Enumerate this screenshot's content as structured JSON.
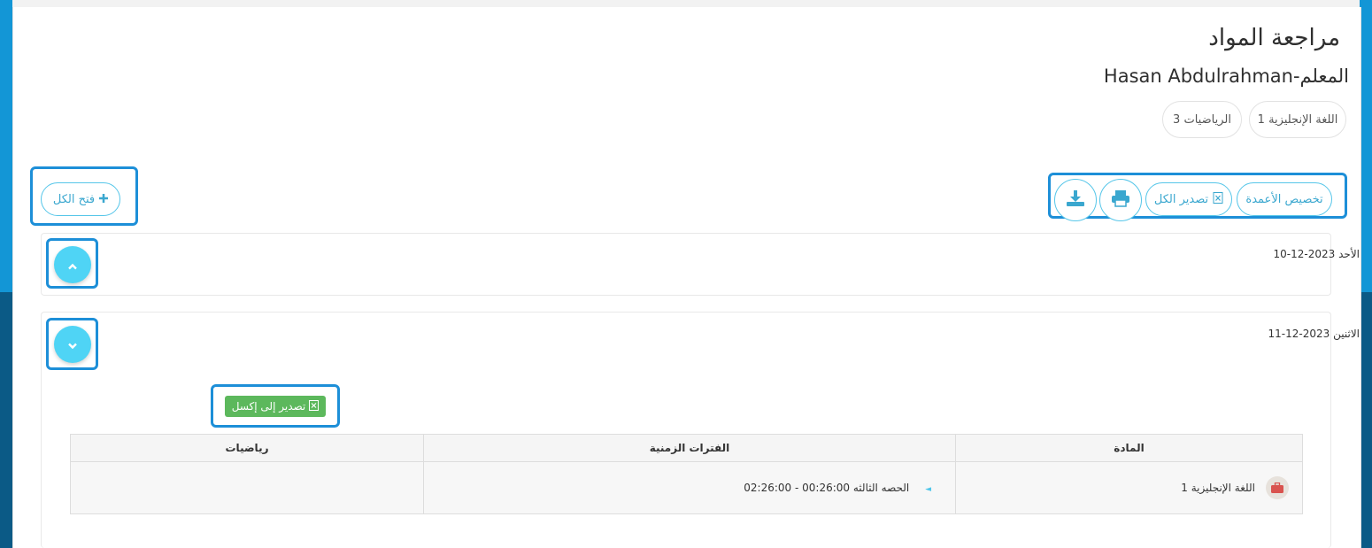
{
  "page": {
    "title": "مراجعة المواد",
    "teacher": "المعلم-Hasan Abdulrahman"
  },
  "subject_tabs": [
    "اللغة الإنجليزية 1",
    "الرياضيات 3"
  ],
  "toolbar": {
    "customize_columns": "تخصيص الأعمدة",
    "export_all": "تصدير الكل",
    "expand_all": "فتح الكل"
  },
  "days": [
    {
      "label": "الأحد 2023-12-10",
      "expanded": false
    },
    {
      "label": "الاثنين 2023-12-11",
      "expanded": true
    }
  ],
  "excel_button": "تصدير إلى إكسل",
  "table": {
    "headers": [
      "المادة",
      "الفترات الزمنية",
      "رياضيات"
    ],
    "rows": [
      {
        "subject": "اللغة الإنجليزية 1",
        "period": "الحصه الثالثه 00:26:00 - 02:26:00",
        "math": ""
      }
    ]
  },
  "icons": {
    "export_all": "excel-file-icon",
    "print": "printer-icon",
    "download": "download-icon",
    "expand_all": "plus-icon",
    "collapse": "chevron-up-icon",
    "expand": "chevron-down-icon",
    "subject": "briefcase-icon"
  },
  "colors": {
    "accent": "#4fd4f5",
    "excel": "#5cb85c",
    "highlight": "#1d8fd8"
  }
}
